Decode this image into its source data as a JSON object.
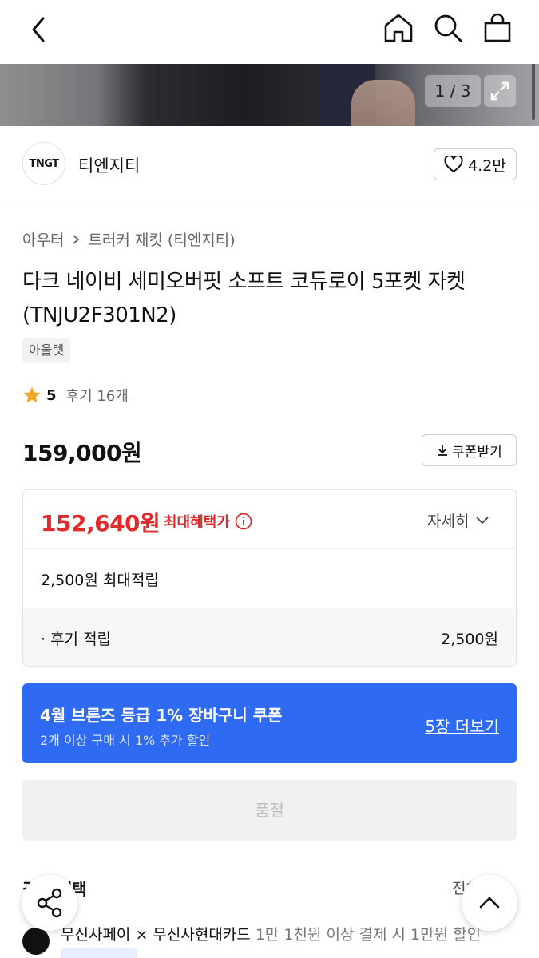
{
  "header": {
    "back_icon": "chevron-left-icon",
    "home_icon": "home-icon",
    "search_icon": "search-icon",
    "bag_icon": "shopping-bag-icon"
  },
  "gallery": {
    "pager": "1 / 3",
    "expand_icon": "expand-icon"
  },
  "brand": {
    "logo_text": "TNGT",
    "name": "티엔지티",
    "likes": "4.2만"
  },
  "breadcrumb": {
    "category": "아우터",
    "subcategory": "트러커 재킷 (티엔지티)"
  },
  "product": {
    "title": "다크 네이비 세미오버핏 소프트 코듀로이 5포켓 자켓 (TNJU2F301N2)",
    "tag": "아울렛",
    "rating": "5",
    "reviews": "후기 16개",
    "price": "159,000원",
    "coupon_button": "쿠폰받기"
  },
  "benefit": {
    "best_price": "152,640원",
    "best_label": "최대혜택가",
    "detail": "자세히",
    "max_points": "2,500원 최대적립",
    "review_points_label": "· 후기 적립",
    "review_points_value": "2,500원"
  },
  "promo": {
    "title": "4월 브론즈 등급 1% 장바구니 쿠폰",
    "subtitle": "2개 이상 구매 시 1% 추가 할인",
    "more": "5장 더보기"
  },
  "actions": {
    "soldout": "품절"
  },
  "section": {
    "title": "결제 혜택",
    "all": "전체"
  },
  "payment": {
    "brand_a": "무신사페이",
    "cross": "×",
    "brand_b": "무신사현대카드",
    "desc": "1만 1천원 이상 결제 시 1만원 할인"
  },
  "colors": {
    "accent_red": "#e02b2b",
    "promo_blue": "#2f6bf2",
    "star": "#f5a623"
  }
}
